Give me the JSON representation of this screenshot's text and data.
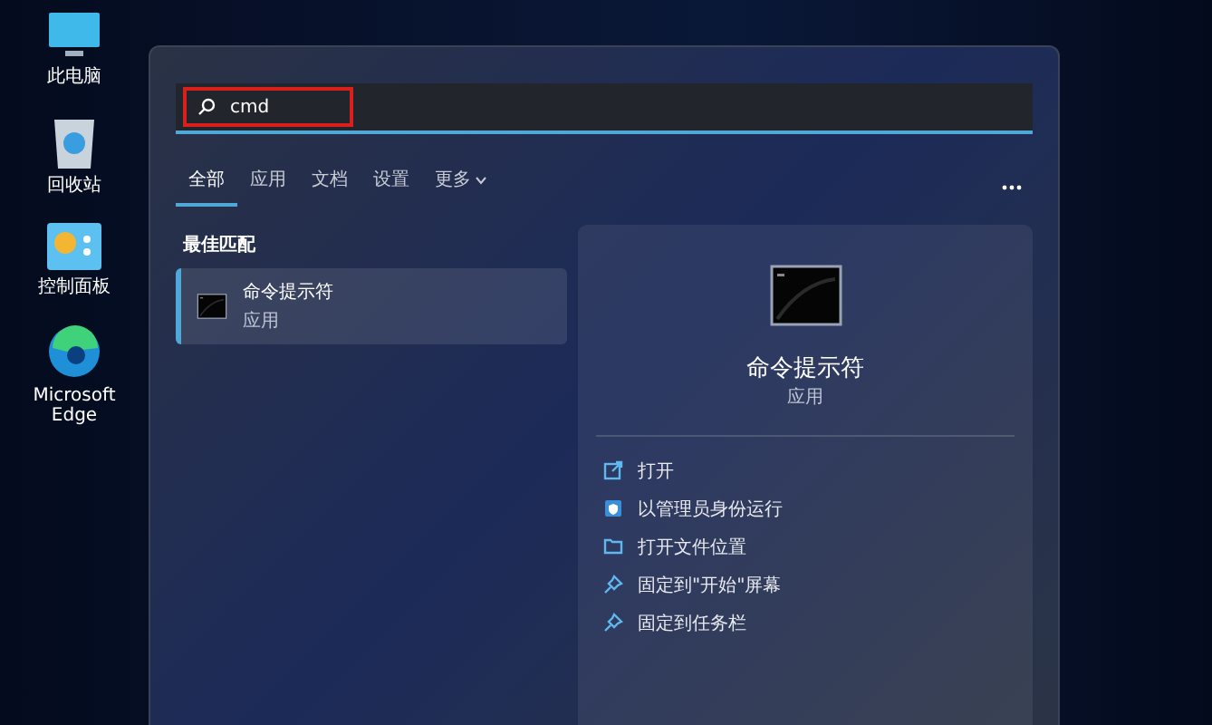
{
  "desktop_icons": [
    {
      "label": "此电脑",
      "kind": "computer"
    },
    {
      "label": "回收站",
      "kind": "bin"
    },
    {
      "label": "控制面板",
      "kind": "control"
    },
    {
      "label": "Microsoft Edge",
      "kind": "edge"
    }
  ],
  "search": {
    "value": "cmd"
  },
  "tabs": [
    {
      "label": "全部",
      "selected": true
    },
    {
      "label": "应用",
      "selected": false
    },
    {
      "label": "文档",
      "selected": false
    },
    {
      "label": "设置",
      "selected": false
    },
    {
      "label": "更多",
      "selected": false
    }
  ],
  "section_title": "最佳匹配",
  "best_match": {
    "title": "命令提示符",
    "subtitle": "应用",
    "selected": true
  },
  "detail": {
    "title": "命令提示符",
    "subtitle": "应用",
    "actions": [
      {
        "label": "打开",
        "kind": "open"
      },
      {
        "label": "以管理员身份运行",
        "kind": "admin"
      },
      {
        "label": "打开文件位置",
        "kind": "folder"
      },
      {
        "label": "固定到\"开始\"屏幕",
        "kind": "pin"
      },
      {
        "label": "固定到任务栏",
        "kind": "pin"
      }
    ]
  }
}
